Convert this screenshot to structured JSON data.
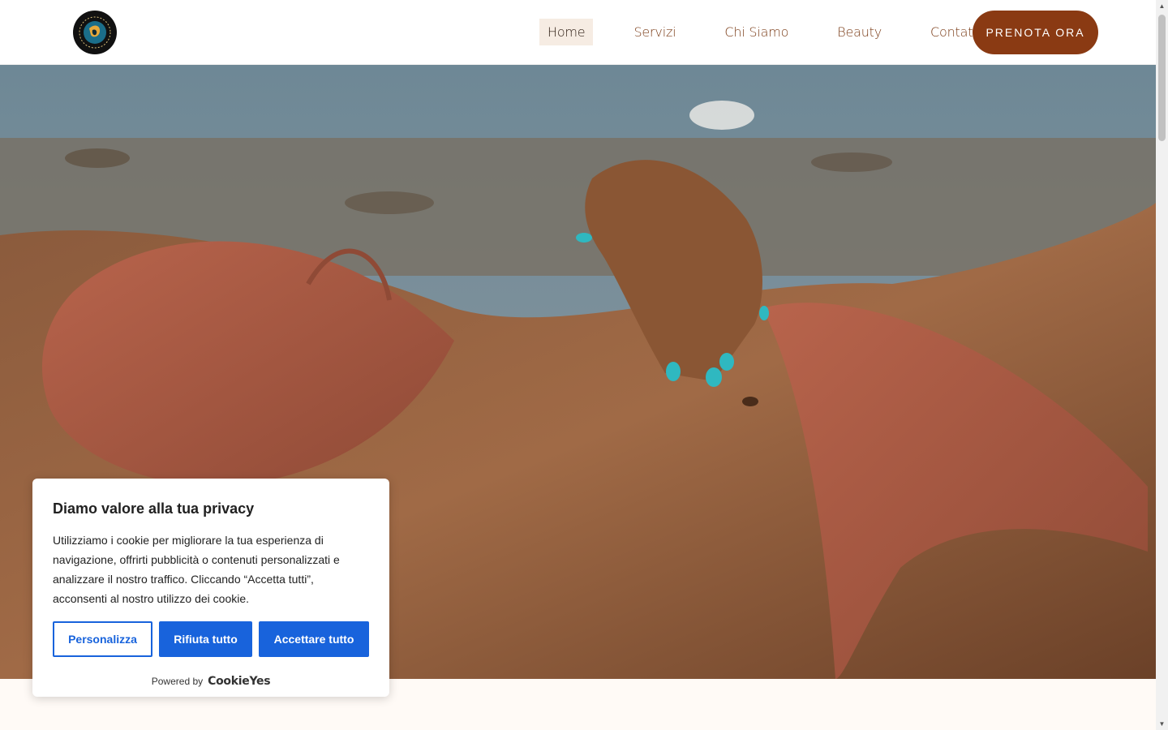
{
  "header": {
    "logo_alt": "Body Revolution",
    "nav": [
      {
        "label": "Home",
        "active": true
      },
      {
        "label": "Servizi",
        "active": false
      },
      {
        "label": "Chi Siamo",
        "active": false
      },
      {
        "label": "Beauty",
        "active": false
      },
      {
        "label": "Contatti",
        "active": false
      }
    ],
    "cta_label": "PRENOTA ORA"
  },
  "cookie_banner": {
    "title": "Diamo valore alla tua privacy",
    "text": "Utilizziamo i cookie per migliorare la tua esperienza di navigazione, offrirti pubblicità o contenuti personalizzati e analizzare il nostro traffico. Cliccando “Accetta tutti”, acconsenti al nostro utilizzo dei cookie.",
    "customize_label": "Personalizza",
    "reject_label": "Rifiuta tutto",
    "accept_label": "Accettare tutto",
    "powered_by": "Powered by",
    "brand": "CookieYes"
  },
  "colors": {
    "brand_brown": "#8a3a13",
    "nav_text": "#7a3b16",
    "cookie_blue": "#1863dc"
  },
  "icons": {
    "logo": "circular-body-revolution-logo",
    "scroll_up": "triangle-up-icon",
    "scroll_down": "triangle-down-icon"
  }
}
